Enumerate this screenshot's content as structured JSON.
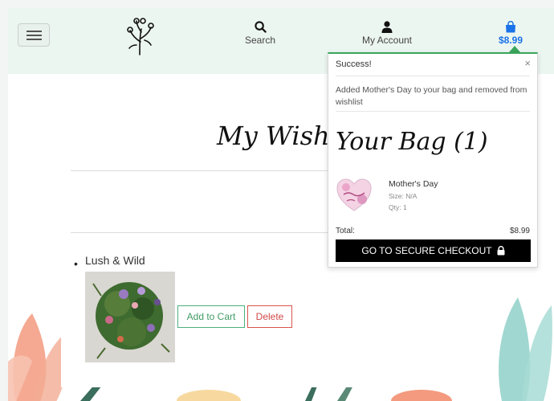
{
  "header": {
    "search_label": "Search",
    "account_label": "My Account",
    "bag_total": "$8.99"
  },
  "wishlist": {
    "title": "My Wishlis",
    "items": [
      {
        "name": "Lush & Wild",
        "add_label": "Add to Cart",
        "delete_label": "Delete"
      }
    ]
  },
  "toast": {
    "heading": "Success!",
    "close": "×",
    "message": "Added Mother's Day to your bag and removed from wishlist",
    "bag_title": "Your Bag (1)",
    "item_name": "Mother's Day",
    "item_size": "Size: N/A",
    "item_qty": "Qty: 1",
    "total_label": "Total:",
    "total_value": "$8.99",
    "checkout_label": "GO TO SECURE CHECKOUT"
  },
  "icons": {
    "logo": "flower-logo-icon",
    "search": "search-icon",
    "account": "user-icon",
    "bag": "shopping-bag-icon",
    "lock": "lock-icon"
  },
  "colors": {
    "header_bg": "#ecf6f1",
    "accent_blue": "#1a73e8",
    "success_green": "#3aa55b",
    "cart_green": "#3f9b66",
    "delete_red": "#d04b48",
    "checkout_bg": "#000000"
  }
}
